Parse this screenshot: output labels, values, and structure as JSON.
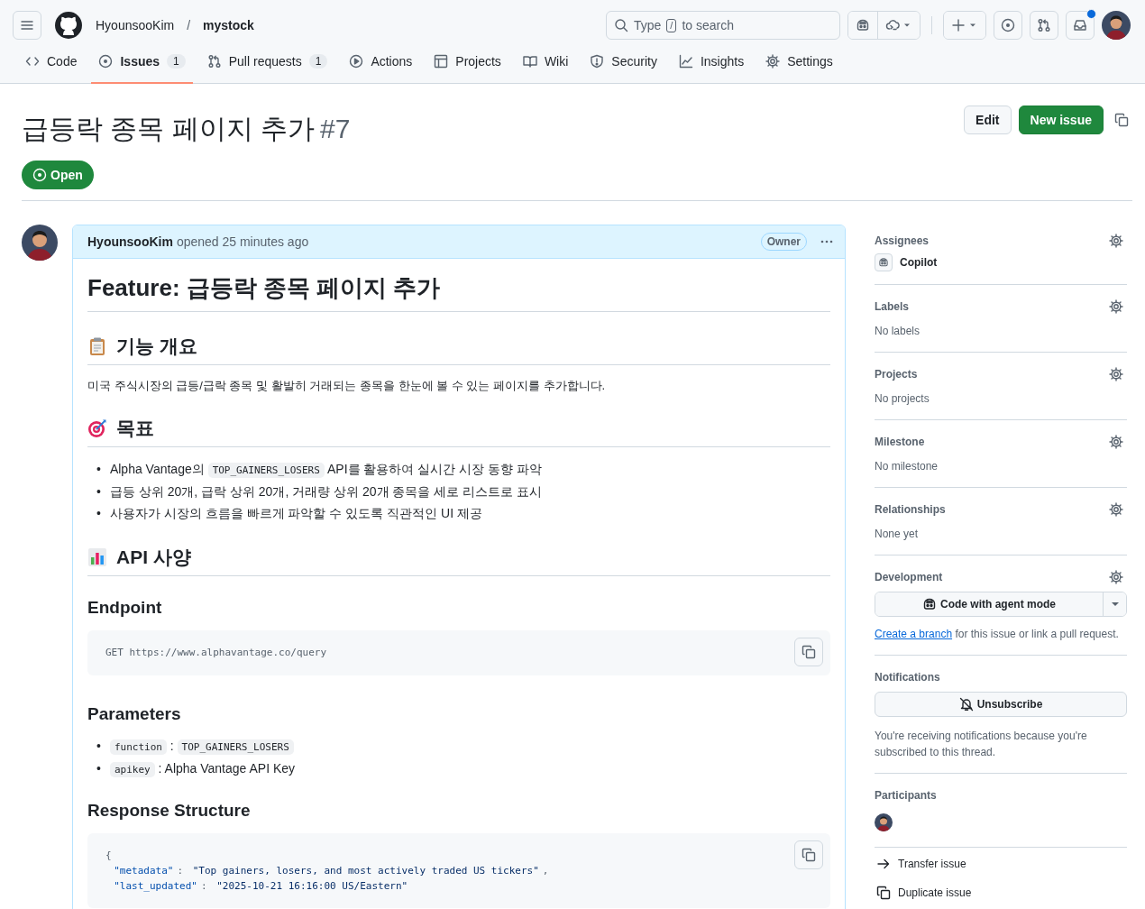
{
  "header": {
    "owner": "HyounsooKim",
    "separator": "/",
    "repo": "mystock",
    "search": {
      "before": "Type",
      "key": "/",
      "after": "to search"
    },
    "inbox_unread": true
  },
  "repo_tabs": [
    {
      "label": "Code",
      "selected": false
    },
    {
      "label": "Issues",
      "count": "1",
      "selected": true
    },
    {
      "label": "Pull requests",
      "count": "1",
      "selected": false
    },
    {
      "label": "Actions",
      "selected": false
    },
    {
      "label": "Projects",
      "selected": false
    },
    {
      "label": "Wiki",
      "selected": false
    },
    {
      "label": "Security",
      "selected": false
    },
    {
      "label": "Insights",
      "selected": false
    },
    {
      "label": "Settings",
      "selected": false
    }
  ],
  "issue": {
    "title": "급등락 종목 페이지 추가",
    "number": "#7",
    "state": "Open",
    "buttons": [
      "Edit",
      "New issue"
    ]
  },
  "comment": {
    "author": "HyounsooKim",
    "meta": "opened 25 minutes ago",
    "role": "Owner",
    "body": [
      {
        "kind": "h1",
        "text": "Feature: 급등락 종목 페이지 추가"
      },
      {
        "kind": "h2",
        "text": "기능 개요"
      },
      {
        "kind": "p",
        "text": "미국 주식시장의 급등/급락 종목 및 활발히 거래되는 종목을 한눈에 볼 수 있는 페이지를 추가합니다."
      },
      {
        "kind": "h2",
        "text": "목표"
      },
      {
        "kind": "ul",
        "items": [
          {
            "marker": "•",
            "segments": [
              {
                "text": "Alpha Vantage의 ",
                "code": false
              },
              {
                "text": "TOP_GAINERS_LOSERS",
                "code": true
              },
              {
                "text": " API를 활용하여 실시간 시장 동향 파악",
                "code": false
              }
            ]
          },
          {
            "marker": "•",
            "segments": [
              {
                "text": "급등 상위 20개, 급락 상위 20개, 거래량 상위 20개 종목을 세로 리스트로 표시",
                "code": false
              }
            ]
          },
          {
            "marker": "•",
            "segments": [
              {
                "text": "사용자가 시장의 흐름을 빠르게 파악할 수 있도록 직관적인 UI 제공",
                "code": false
              }
            ]
          }
        ]
      },
      {
        "kind": "h2",
        "text": "API 사양"
      },
      {
        "kind": "h3",
        "text": "Endpoint"
      },
      {
        "kind": "code",
        "lines": [
          [
            {
              "text": "GET https://www.alphavantage.co/query",
              "kind": "plain"
            }
          ]
        ]
      },
      {
        "kind": "h3",
        "text": "Parameters"
      },
      {
        "kind": "ul",
        "items": [
          {
            "marker": "•",
            "segments": [
              {
                "text": "function",
                "code": true
              },
              {
                "text": " : ",
                "code": false
              },
              {
                "text": "TOP_GAINERS_LOSERS",
                "code": true
              }
            ]
          },
          {
            "marker": "•",
            "segments": [
              {
                "text": "apikey",
                "code": true
              },
              {
                "text": " : Alpha Vantage API Key",
                "code": false
              }
            ]
          }
        ]
      },
      {
        "kind": "h3",
        "text": "Response Structure"
      },
      {
        "kind": "code",
        "lines": [
          [
            {
              "text": "{",
              "kind": "plain"
            }
          ],
          [
            {
              "text": "  \"metadata\"",
              "kind": "key"
            },
            {
              "text": ": ",
              "kind": "plain"
            },
            {
              "text": "\"Top gainers, losers, and most actively traded US tickers\"",
              "kind": "string"
            },
            {
              "text": ",",
              "kind": "plain"
            }
          ],
          [
            {
              "text": "  \"last_updated\"",
              "kind": "key"
            },
            {
              "text": ": ",
              "kind": "plain"
            },
            {
              "text": "\"2025-10-21 16:16:00 US/Eastern\"",
              "kind": "string"
            }
          ]
        ]
      }
    ]
  },
  "sidebar": {
    "sections": [
      {
        "title": "Assignees",
        "kind": "assignee",
        "configurable": true,
        "name": "Copilot"
      },
      {
        "title": "Labels",
        "kind": "empty",
        "configurable": true,
        "text": "No labels"
      },
      {
        "title": "Projects",
        "kind": "empty",
        "configurable": true,
        "text": "No projects"
      },
      {
        "title": "Milestone",
        "kind": "empty",
        "configurable": true,
        "text": "No milestone"
      },
      {
        "title": "Relationships",
        "kind": "empty",
        "configurable": true,
        "text": "None yet"
      },
      {
        "title": "Development",
        "kind": "development",
        "configurable": true,
        "button": "Code with agent mode",
        "link": "Create a branch",
        "note": "for this issue or link a pull request."
      },
      {
        "title": "Notifications",
        "kind": "notifications",
        "configurable": false,
        "button": "Unsubscribe",
        "note": "You're receiving notifications because you're subscribed to this thread."
      },
      {
        "title": "Participants",
        "kind": "participants",
        "configurable": false
      }
    ],
    "actions": [
      {
        "label": "Transfer issue"
      },
      {
        "label": "Duplicate issue"
      }
    ]
  }
}
